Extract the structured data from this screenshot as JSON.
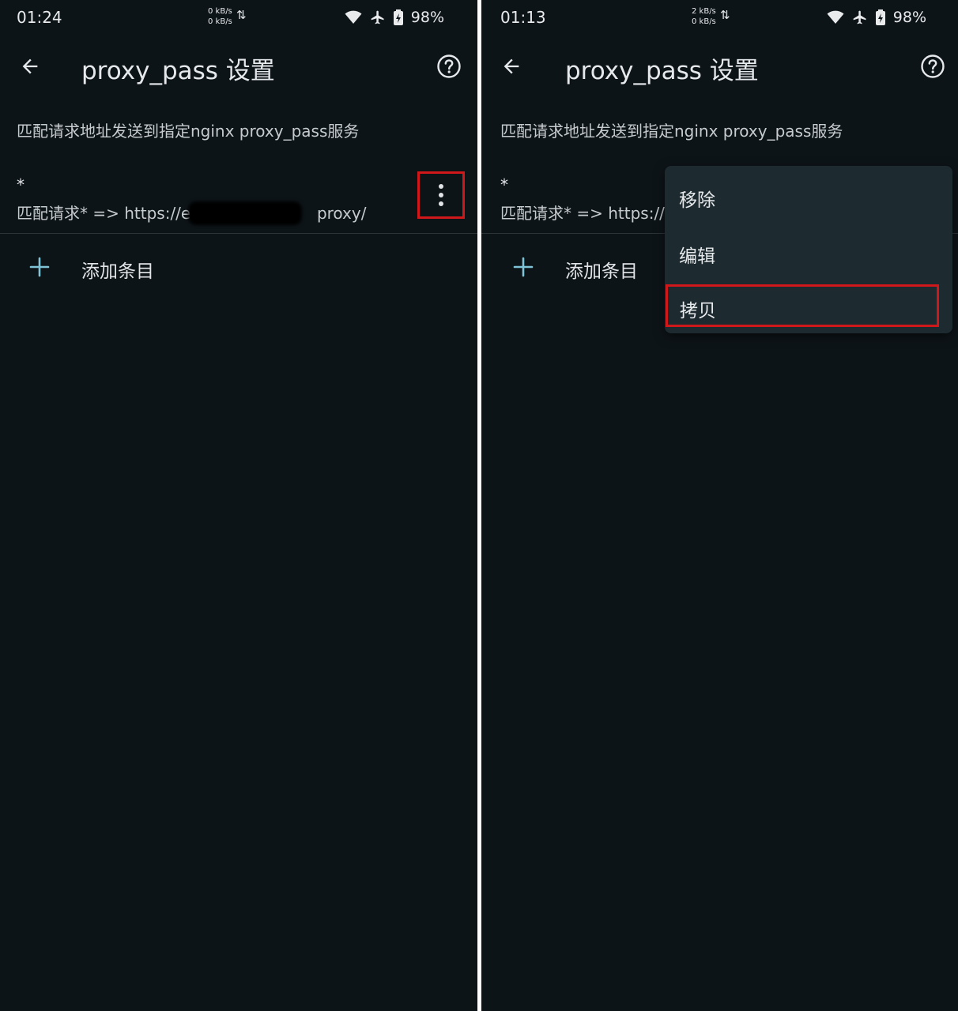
{
  "screens": [
    {
      "status": {
        "time": "01:24",
        "net_up": "0 kB/s",
        "net_down": "0 kB/s",
        "net_arrows": "⇅",
        "battery": "98%"
      },
      "app_bar": {
        "title": "proxy_pass 设置"
      },
      "description": "匹配请求地址发送到指定nginx proxy_pass服务",
      "entry": {
        "title": "*",
        "subtitle_prefix": "匹配请求* => https://ec0",
        "subtitle_suffix": "proxy/"
      },
      "add_label": "添加条目"
    },
    {
      "status": {
        "time": "01:13",
        "net_up": "2 kB/s",
        "net_down": "0 kB/s",
        "net_arrows": "⇅",
        "battery": "98%"
      },
      "app_bar": {
        "title": "proxy_pass 设置"
      },
      "description": "匹配请求地址发送到指定nginx proxy_pass服务",
      "entry": {
        "title": "*",
        "subtitle_prefix": "匹配请求* => https://ec"
      },
      "add_label": "添加条目",
      "menu": {
        "items": [
          "移除",
          "编辑",
          "拷贝"
        ]
      }
    }
  ],
  "icons": {
    "back": "arrow-left-icon",
    "help": "help-circle-icon",
    "more": "more-vertical-icon",
    "add": "plus-icon",
    "wifi": "wifi-icon",
    "airplane": "airplane-icon",
    "battery": "battery-charging-icon"
  },
  "colors": {
    "background": "#0d1418",
    "menu_background": "#1d2a30",
    "accent": "#7fc4d6",
    "highlight_border": "#d0171a"
  }
}
